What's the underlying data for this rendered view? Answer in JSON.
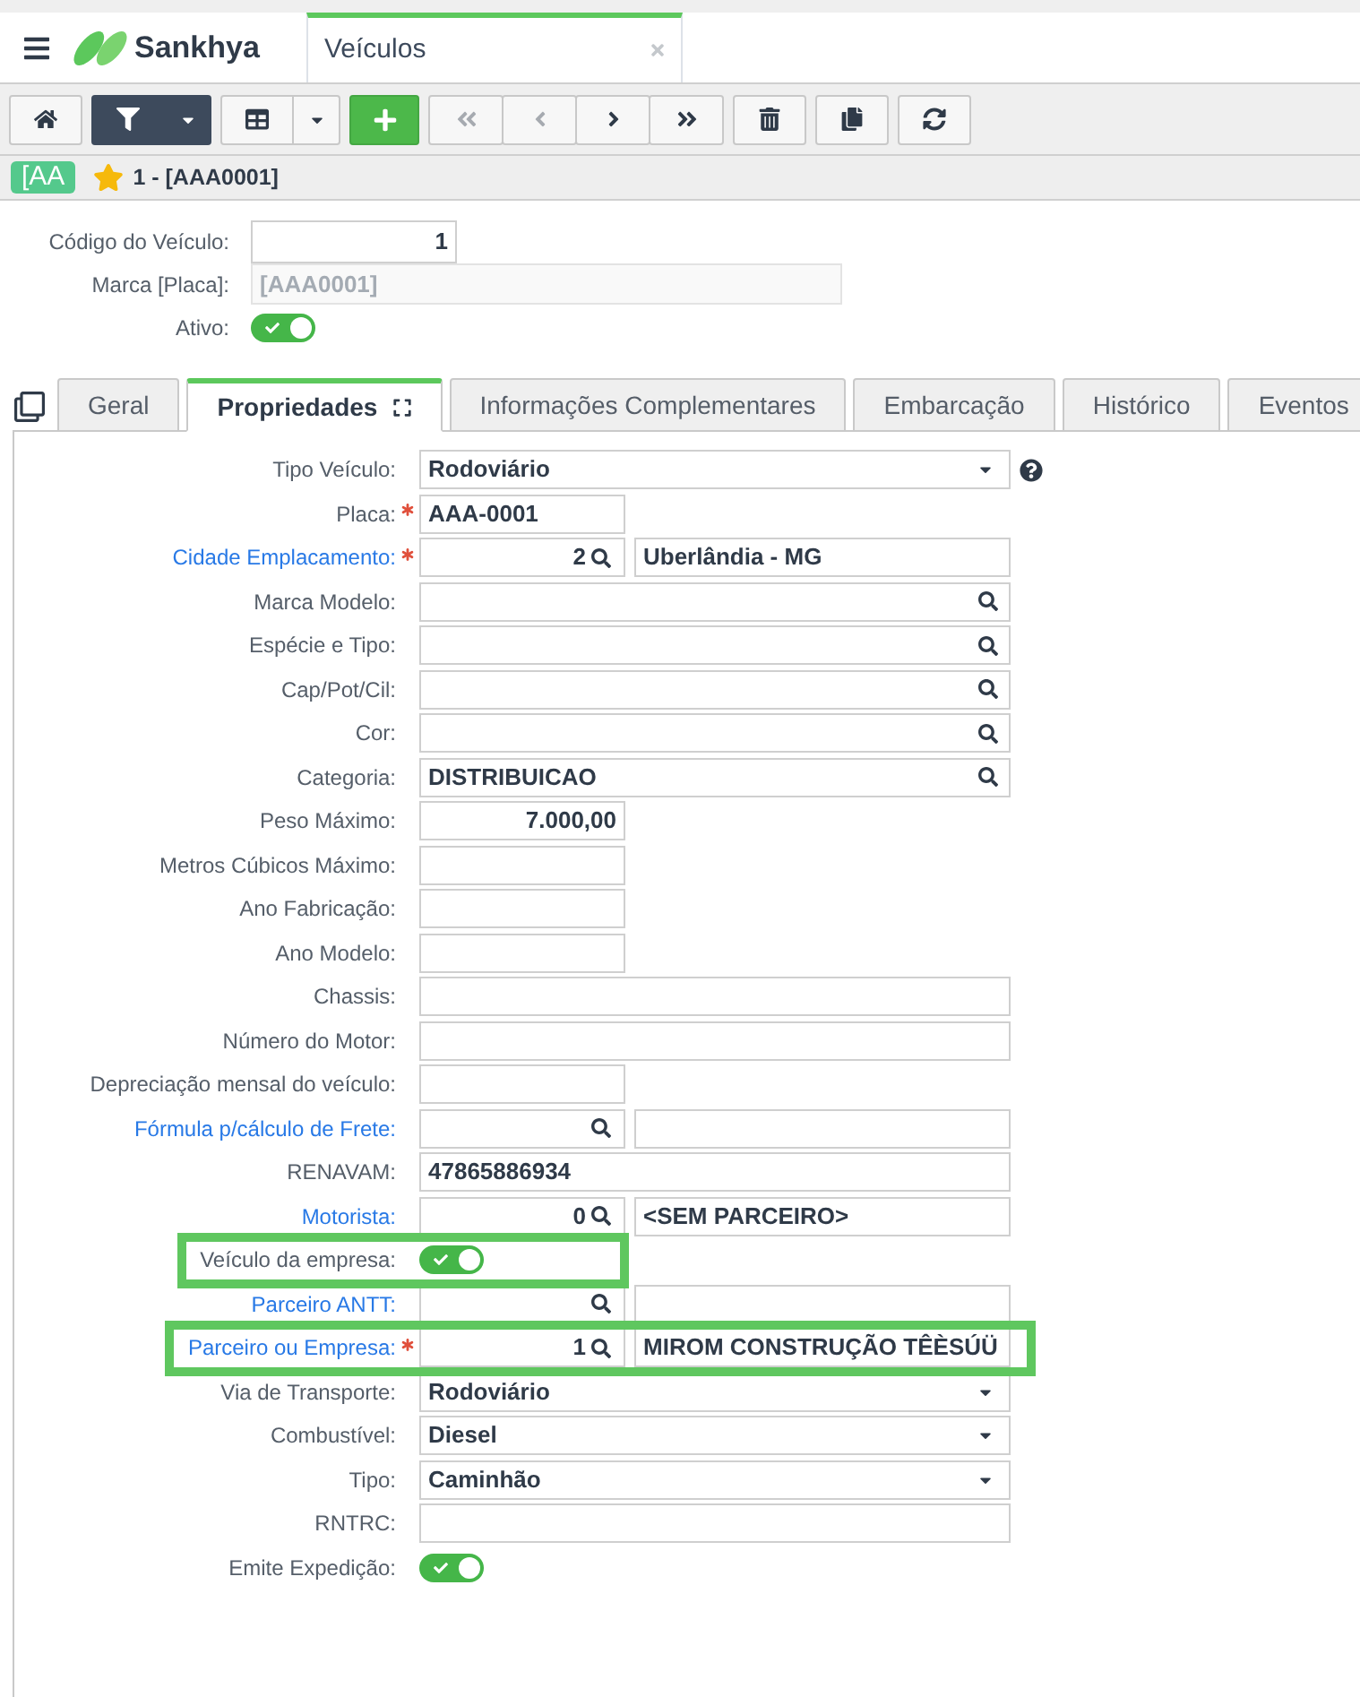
{
  "header": {
    "brand": "Sankhya",
    "tab": {
      "title": "Veículos"
    }
  },
  "toolbar": [
    {
      "kind": "home",
      "active": false,
      "disabled": false
    },
    {
      "kind": "filter",
      "active": true,
      "disabled": false
    },
    {
      "kind": "grid",
      "active": false,
      "disabled": false
    },
    {
      "kind": "add",
      "active": false,
      "disabled": false
    },
    {
      "kind": "first",
      "active": false,
      "disabled": true
    },
    {
      "kind": "previous",
      "active": false,
      "disabled": true
    },
    {
      "kind": "next",
      "active": false,
      "disabled": false
    },
    {
      "kind": "last",
      "active": false,
      "disabled": false
    },
    {
      "kind": "delete",
      "active": false,
      "disabled": false
    },
    {
      "kind": "duplicate",
      "active": false,
      "disabled": false
    },
    {
      "kind": "refresh",
      "active": false,
      "disabled": false
    }
  ],
  "record": {
    "badge": "[AA",
    "favorite": true,
    "title": "1 - [AAA0001]"
  },
  "summary": [
    {
      "label": "Código do Veículo:",
      "kind": "number",
      "value": "1",
      "disabled": false
    },
    {
      "label": "Marca [Placa]:",
      "kind": "text",
      "value": "[AAA0001]",
      "disabled": true
    },
    {
      "label": "Ativo:",
      "kind": "switch",
      "on": true,
      "disabled": false
    }
  ],
  "tabs": [
    {
      "label": "Geral",
      "selected": false
    },
    {
      "label": "Propriedades",
      "selected": true
    },
    {
      "label": "Informações Complementares",
      "selected": false
    },
    {
      "label": "Embarcação",
      "selected": false
    },
    {
      "label": "Histórico",
      "selected": false
    },
    {
      "label": "Eventos",
      "selected": false
    }
  ],
  "fields": [
    {
      "label": "Tipo Veículo:",
      "kind": "select",
      "value": "Rodoviário",
      "required": false,
      "link": false,
      "highlighted": false,
      "help": true
    },
    {
      "label": "Placa:",
      "kind": "short",
      "value": "AAA-0001",
      "required": true,
      "link": false,
      "highlighted": false,
      "help": false
    },
    {
      "label": "Cidade Emplacamento:",
      "kind": "pair",
      "code": "2",
      "description": "Uberlândia - MG",
      "required": true,
      "link": true,
      "highlighted": false,
      "help": false
    },
    {
      "label": "Marca Modelo:",
      "kind": "lookup",
      "required": false,
      "link": false,
      "highlighted": false,
      "help": false
    },
    {
      "label": "Espécie e Tipo:",
      "kind": "lookup",
      "required": false,
      "link": false,
      "highlighted": false,
      "help": false
    },
    {
      "label": "Cap/Pot/Cil:",
      "kind": "lookup",
      "required": false,
      "link": false,
      "highlighted": false,
      "help": false
    },
    {
      "label": "Cor:",
      "kind": "lookup",
      "required": false,
      "link": false,
      "highlighted": false,
      "help": false
    },
    {
      "label": "Categoria:",
      "kind": "lookup",
      "value": "DISTRIBUICAO",
      "required": false,
      "link": false,
      "highlighted": false,
      "help": false
    },
    {
      "label": "Peso Máximo:",
      "kind": "number",
      "value": "7.000,00",
      "required": false,
      "link": false,
      "highlighted": false,
      "help": false
    },
    {
      "label": "Metros Cúbicos Máximo:",
      "kind": "number",
      "required": false,
      "link": false,
      "highlighted": false,
      "help": false
    },
    {
      "label": "Ano Fabricação:",
      "kind": "number",
      "required": false,
      "link": false,
      "highlighted": false,
      "help": false
    },
    {
      "label": "Ano Modelo:",
      "kind": "number",
      "required": false,
      "link": false,
      "highlighted": false,
      "help": false
    },
    {
      "label": "Chassis:",
      "kind": "text",
      "required": false,
      "link": false,
      "highlighted": false,
      "help": false
    },
    {
      "label": "Número do Motor:",
      "kind": "text",
      "required": false,
      "link": false,
      "highlighted": false,
      "help": false
    },
    {
      "label": "Depreciação mensal do veículo:",
      "kind": "number",
      "required": false,
      "link": false,
      "highlighted": false,
      "help": false
    },
    {
      "label": "Fórmula p/cálculo de Frete:",
      "kind": "pair",
      "required": false,
      "link": true,
      "highlighted": false,
      "help": false
    },
    {
      "label": "RENAVAM:",
      "kind": "text",
      "value": "47865886934",
      "required": false,
      "link": false,
      "highlighted": false,
      "help": false
    },
    {
      "label": "Motorista:",
      "kind": "pair",
      "code": "0",
      "description": "<SEM PARCEIRO>",
      "required": false,
      "link": true,
      "highlighted": false,
      "help": false
    },
    {
      "label": "Veículo da empresa:",
      "kind": "switch",
      "on": true,
      "required": false,
      "link": false,
      "highlighted": true,
      "help": false
    },
    {
      "label": "Parceiro ANTT:",
      "kind": "pair",
      "required": false,
      "link": true,
      "highlighted": false,
      "help": false
    },
    {
      "label": "Parceiro ou Empresa:",
      "kind": "pair",
      "code": "1",
      "description": "MIROM CONSTRUÇÃO TÊÈSÚÜ",
      "required": true,
      "link": true,
      "highlighted": true,
      "help": false
    },
    {
      "label": "Via de Transporte:",
      "kind": "select",
      "value": "Rodoviário",
      "required": false,
      "link": false,
      "highlighted": false,
      "help": false
    },
    {
      "label": "Combustível:",
      "kind": "select",
      "value": "Diesel",
      "required": false,
      "link": false,
      "highlighted": false,
      "help": false
    },
    {
      "label": "Tipo:",
      "kind": "select",
      "value": "Caminhão",
      "required": false,
      "link": false,
      "highlighted": false,
      "help": false
    },
    {
      "label": "RNTRC:",
      "kind": "text",
      "required": false,
      "link": false,
      "highlighted": false,
      "help": false
    },
    {
      "label": "Emite Expedição:",
      "kind": "switch",
      "on": true,
      "required": false,
      "link": false,
      "highlighted": false,
      "help": false
    }
  ]
}
